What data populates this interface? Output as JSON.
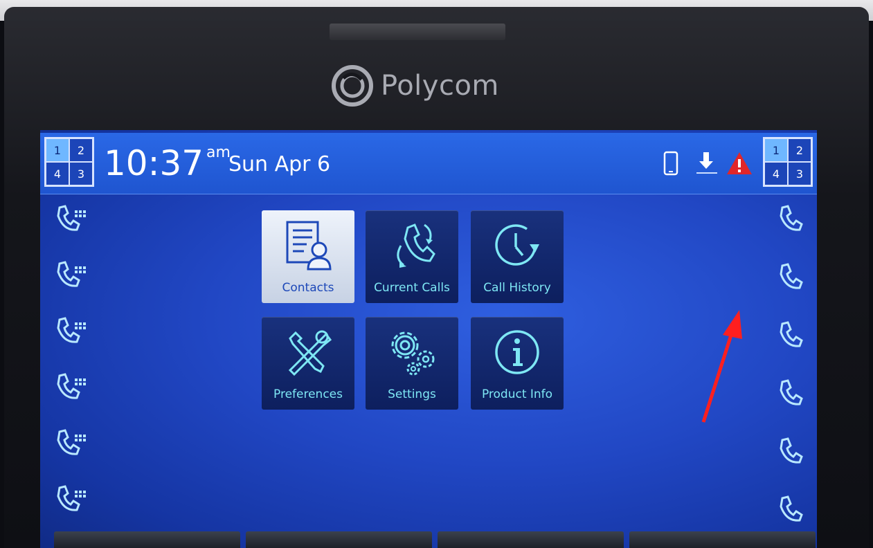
{
  "device": {
    "brand": "Polycom"
  },
  "status_bar": {
    "time": "10:37",
    "ampm": "am",
    "date": "Sun Apr 6",
    "page_indicator_left": [
      "1",
      "2",
      "4",
      "3"
    ],
    "page_indicator_right": [
      "1",
      "2",
      "4",
      "3"
    ],
    "active_page": "1",
    "icons": [
      "mobile-device-icon",
      "download-icon",
      "warning-icon"
    ]
  },
  "apps": [
    {
      "label": "Contacts",
      "icon": "contacts-icon",
      "selected": true
    },
    {
      "label": "Current Calls",
      "icon": "current-calls-icon",
      "selected": false
    },
    {
      "label": "Call History",
      "icon": "call-history-icon",
      "selected": false
    },
    {
      "label": "Preferences",
      "icon": "preferences-icon",
      "selected": false
    },
    {
      "label": "Settings",
      "icon": "settings-icon",
      "selected": false
    },
    {
      "label": "Product Info",
      "icon": "product-info-icon",
      "selected": false
    }
  ],
  "line_keys": {
    "left_count": 6,
    "right_count": 6
  },
  "colors": {
    "screen_blue": "#2147c4",
    "label_cyan": "#7ee7f4",
    "warning_red": "#e0262a",
    "annotation_arrow": "#ff1f1f"
  }
}
